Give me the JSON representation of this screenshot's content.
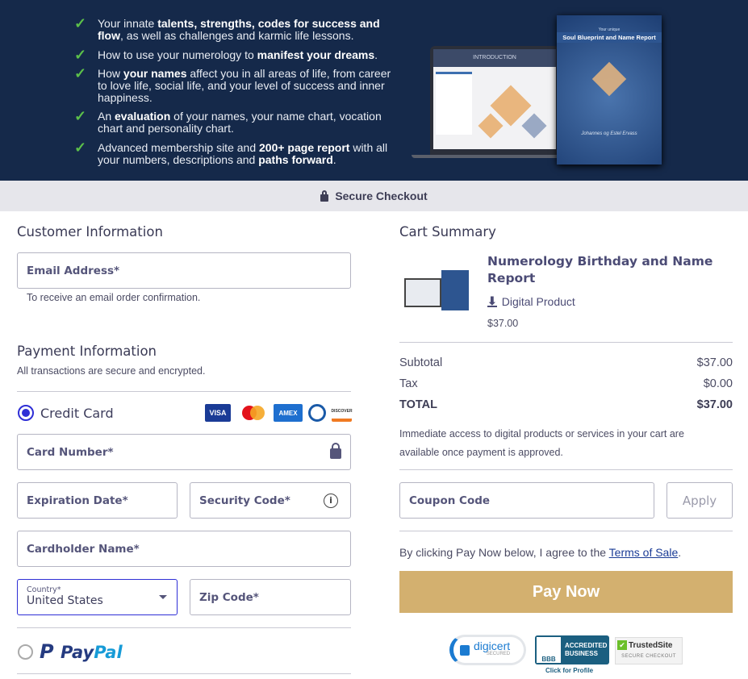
{
  "hero": {
    "features": [
      {
        "parts": [
          [
            "Your innate ",
            false
          ],
          [
            "talents, strengths, codes for success and flow",
            true
          ],
          [
            ", as well as challenges and karmic life lessons.",
            false
          ]
        ]
      },
      {
        "parts": [
          [
            "How to use your numerology to ",
            false
          ],
          [
            "manifest your dreams",
            true
          ],
          [
            ".",
            false
          ]
        ]
      },
      {
        "parts": [
          [
            "How ",
            false
          ],
          [
            "your names",
            true
          ],
          [
            " affect you in all areas of life, from career to love life, social life, and your level of success and inner happiness.",
            false
          ]
        ]
      },
      {
        "parts": [
          [
            "An ",
            false
          ],
          [
            "evaluation",
            true
          ],
          [
            " of your names, your name chart, vocation chart and personality chart.",
            false
          ]
        ]
      },
      {
        "parts": [
          [
            "Advanced membership site and ",
            false
          ],
          [
            "200+ page report",
            true
          ],
          [
            " with all your numbers, descriptions and ",
            false
          ],
          [
            "paths forward",
            true
          ],
          [
            ".",
            false
          ]
        ]
      }
    ],
    "laptop_title": "INTRODUCTION",
    "book_subtitle": "Your unique",
    "book_title": "Soul Blueprint and Name Report",
    "book_authors": "Johannes og Estel Ervass"
  },
  "secure_checkout": "Secure Checkout",
  "customer": {
    "title": "Customer Information",
    "email_label": "Email Address*",
    "email_help": "To receive an email order confirmation."
  },
  "payment": {
    "title": "Payment Information",
    "subtitle": "All transactions are secure and encrypted.",
    "credit_card_label": "Credit Card",
    "cards": [
      "VISA",
      "MC",
      "AMEX",
      "Diners",
      "DISCOVER"
    ],
    "card_number": "Card Number*",
    "expiration": "Expiration Date*",
    "security_code": "Security Code*",
    "cardholder": "Cardholder Name*",
    "country_label": "Country*",
    "country_value": "United States",
    "zip": "Zip Code*",
    "paypal_a": "Pay",
    "paypal_b": "Pal",
    "selected_method": "Credit Card"
  },
  "cart": {
    "title": "Cart Summary",
    "product_name": "Numerology Birthday and Name Report",
    "product_type": "Digital Product",
    "product_price": "$37.00",
    "subtotal_label": "Subtotal",
    "subtotal": "$37.00",
    "tax_label": "Tax",
    "tax": "$0.00",
    "total_label": "TOTAL",
    "total": "$37.00",
    "access_note": "Immediate access to digital products or services in your cart are available once payment is approved.",
    "coupon_placeholder": "Coupon Code",
    "apply": "Apply",
    "agree_prefix": "By clicking Pay Now below, I agree to the ",
    "terms_link": "Terms of Sale",
    "agree_suffix": ".",
    "pay_now": "Pay Now"
  },
  "badges": {
    "digicert": "digicert",
    "digicert_sub": "SECURED",
    "bbb_a": "ACCREDITED",
    "bbb_b": "BUSINESS",
    "bbb_logo": "BBB",
    "bbb_link": "Click for Profile",
    "trusted": "TrustedSite",
    "trusted_sub": "SECURE CHECKOUT"
  },
  "colors": {
    "hero_bg": "#15294a",
    "accent": "#2f2fd6",
    "pay_button": "#d3b06f",
    "check": "#5cc04a"
  }
}
